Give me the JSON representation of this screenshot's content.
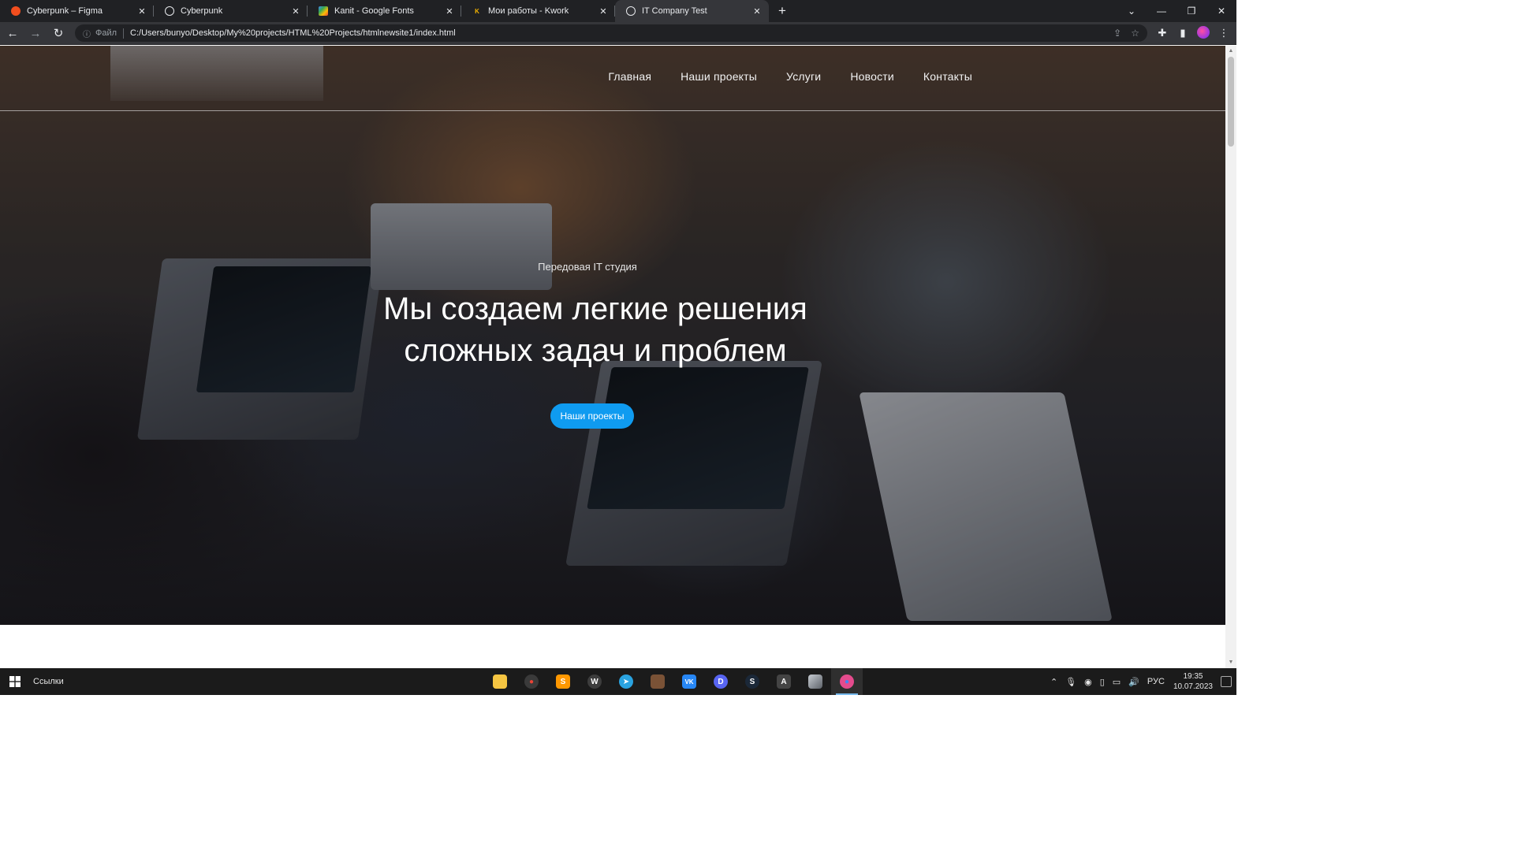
{
  "browser": {
    "tabs": [
      {
        "title": "Cyberpunk – Figma",
        "icon": "figma-icon",
        "color": "#f24e1e"
      },
      {
        "title": "Cyberpunk",
        "icon": "globe-icon",
        "color": "#e8eaed"
      },
      {
        "title": "Kanit - Google Fonts",
        "icon": "google-fonts-icon",
        "color": "#4285f4"
      },
      {
        "title": "Мои работы - Kwork",
        "icon": "kwork-icon",
        "color": "#f4b400"
      },
      {
        "title": "IT Company Test",
        "icon": "globe-icon",
        "color": "#e8eaed"
      }
    ],
    "active_tab": 4,
    "address": {
      "scheme_label": "Файл",
      "url": "C:/Users/bunyo/Desktop/My%20projects/HTML%20Projects/htmlnewsite1/index.html"
    }
  },
  "site": {
    "nav": [
      "Главная",
      "Наши проекты",
      "Услуги",
      "Новости",
      "Контакты"
    ],
    "tagline": "Передовая IT студия",
    "headline_line1": "Мы создаем легкие решения",
    "headline_line2": "сложных задач и проблем",
    "cta_label": "Наши проекты",
    "accent_color": "#0f9bf0"
  },
  "taskbar": {
    "links_label": "Ссылки",
    "apps": [
      {
        "name": "file-explorer-icon",
        "color": "#f5c542",
        "glyph": ""
      },
      {
        "name": "chrome-icon",
        "color": "#3a3a3a",
        "glyph": "●"
      },
      {
        "name": "sublime-text-icon",
        "color": "#ff9800",
        "glyph": "S"
      },
      {
        "name": "wordpress-icon",
        "color": "#3d3d3d",
        "glyph": "W"
      },
      {
        "name": "telegram-icon",
        "color": "#2aa3e0",
        "glyph": "➤"
      },
      {
        "name": "game-icon",
        "color": "#7a5236",
        "glyph": ""
      },
      {
        "name": "vk-icon",
        "color": "#2787f5",
        "glyph": "VK"
      },
      {
        "name": "discord-icon",
        "color": "#5865f2",
        "glyph": "D"
      },
      {
        "name": "steam-icon",
        "color": "#1b2838",
        "glyph": "S"
      },
      {
        "name": "inkscape-icon",
        "color": "#444444",
        "glyph": "A"
      },
      {
        "name": "photo-app-icon",
        "color": "#8a8f96",
        "glyph": ""
      },
      {
        "name": "chrome-profile-icon",
        "color": "#e44b8d",
        "glyph": "●"
      }
    ],
    "active_app": 11,
    "language": "РУС",
    "time": "19:35",
    "date": "10.07.2023"
  }
}
